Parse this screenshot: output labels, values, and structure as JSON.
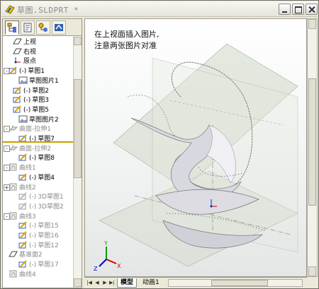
{
  "window": {
    "title": "草图.SLDPRT *"
  },
  "panel_tabs": [
    "feature-manager",
    "property-manager",
    "configuration-manager",
    "dim-xpert-manager"
  ],
  "tree": [
    {
      "prefix": "",
      "label": "上视",
      "icon": "plane-icon",
      "dim": false
    },
    {
      "prefix": "",
      "label": "右视",
      "icon": "plane-icon",
      "dim": false
    },
    {
      "prefix": "",
      "label": "原点",
      "icon": "origin-icon",
      "dim": false
    },
    {
      "prefix": "(-)",
      "label": "草图1",
      "icon": "sketch-icon",
      "dim": false
    },
    {
      "prefix": "",
      "label": "草图图片1",
      "icon": "sketch-picture-icon",
      "dim": false
    },
    {
      "prefix": "(-)",
      "label": "草图2",
      "icon": "sketch-icon",
      "dim": false
    },
    {
      "prefix": "(-)",
      "label": "草图3",
      "icon": "sketch-icon",
      "dim": false
    },
    {
      "prefix": "(-)",
      "label": "草图5",
      "icon": "sketch-icon",
      "dim": false
    },
    {
      "prefix": "",
      "label": "草图图片2",
      "icon": "sketch-picture-icon",
      "dim": false
    },
    {
      "prefix": "",
      "label": "曲面-拉伸1",
      "icon": "surface-extrude-icon",
      "dim": true
    },
    {
      "prefix": "(-)",
      "label": "草图7",
      "icon": "sketch-icon",
      "dim": false
    },
    {
      "prefix": "",
      "label": "曲面-拉伸2",
      "icon": "surface-extrude-icon",
      "dim": true
    },
    {
      "prefix": "(-)",
      "label": "草图8",
      "icon": "sketch-icon",
      "dim": false
    },
    {
      "prefix": "",
      "label": "曲线1",
      "icon": "curve-icon",
      "dim": true
    },
    {
      "prefix": "(-)",
      "label": "草图4",
      "icon": "sketch-icon",
      "dim": false
    },
    {
      "prefix": "",
      "label": "曲线2",
      "icon": "curve-icon",
      "dim": true
    },
    {
      "prefix": "(-)",
      "label": "3D草图1",
      "icon": "sketch3d-icon",
      "dim": true
    },
    {
      "prefix": "(-)",
      "label": "3D草图2",
      "icon": "sketch3d-icon",
      "dim": true
    },
    {
      "prefix": "",
      "label": "曲线3",
      "icon": "curve-icon",
      "dim": true
    },
    {
      "prefix": "(-)",
      "label": "草图15",
      "icon": "sketch-icon",
      "dim": true
    },
    {
      "prefix": "(-)",
      "label": "草图16",
      "icon": "sketch-icon",
      "dim": true
    },
    {
      "prefix": "(-)",
      "label": "草图12",
      "icon": "sketch-icon",
      "dim": true
    },
    {
      "prefix": "",
      "label": "基准面2",
      "icon": "plane-icon",
      "dim": true
    },
    {
      "prefix": "(-)",
      "label": "草图17",
      "icon": "sketch-icon",
      "dim": true
    },
    {
      "prefix": "",
      "label": "曲线4",
      "icon": "curve-icon",
      "dim": true
    }
  ],
  "viewport": {
    "annotation_line1": "在上视面插入图片,",
    "annotation_line2": "注意两张图片对准",
    "triad_labels": {
      "x": "X",
      "y": "Y",
      "z": "Z"
    }
  },
  "bottom_tabs": [
    {
      "label": "模型",
      "active": true
    },
    {
      "label": "动画1",
      "active": false
    }
  ],
  "colors": {
    "title_text": "#8a8a8a",
    "selection_bar": "#c8a000",
    "axis_x": "#d00000",
    "axis_y": "#00a000",
    "axis_z": "#0000d0"
  }
}
